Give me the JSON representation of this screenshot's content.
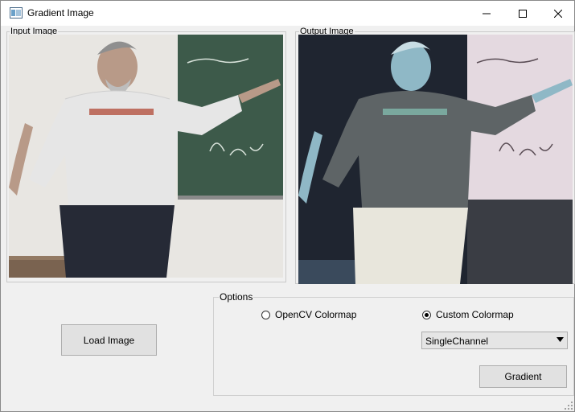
{
  "window": {
    "title": "Gradient Image",
    "app_icon": "image-window-icon"
  },
  "controls": {
    "minimize": "minimize-icon",
    "maximize": "maximize-icon",
    "close": "close-icon"
  },
  "input_panel": {
    "label": "Input Image",
    "image": "photo-man-in-white-tshirt-at-chalkboard"
  },
  "output_panel": {
    "label": "Output Image",
    "image": "photo-colormapped-negative"
  },
  "load_button": {
    "label": "Load Image"
  },
  "options": {
    "label": "Options",
    "radio_opencv": {
      "label": "OpenCV Colormap",
      "checked": false
    },
    "radio_custom": {
      "label": "Custom Colormap",
      "checked": true
    },
    "colormap_select": {
      "value": "SingleChannel"
    },
    "gradient_button": {
      "label": "Gradient"
    }
  }
}
